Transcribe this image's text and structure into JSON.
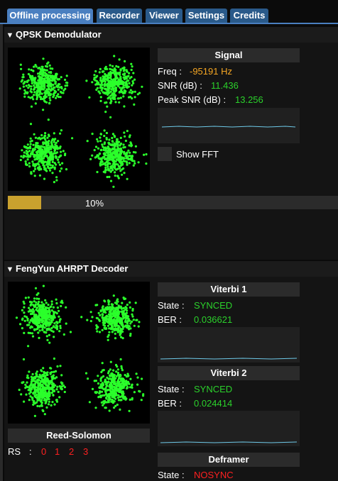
{
  "tabs": [
    {
      "label": "Offline processing",
      "active": true
    },
    {
      "label": "Recorder",
      "active": false
    },
    {
      "label": "Viewer",
      "active": false
    },
    {
      "label": "Settings",
      "active": false
    },
    {
      "label": "Credits",
      "active": false
    }
  ],
  "qpsk": {
    "title": "QPSK Demodulator",
    "signal_title": "Signal",
    "freq_label": "Freq :",
    "freq_value": "-95191 Hz",
    "snr_label": "SNR (dB) :",
    "snr_value": "11.436",
    "peak_label": "Peak SNR (dB) :",
    "peak_value": "13.256",
    "show_fft_label": "Show FFT",
    "progress_text": "10%",
    "progress_fraction": 0.1
  },
  "decoder": {
    "title": "FengYun AHRPT Decoder",
    "viterbi1": {
      "title": "Viterbi 1",
      "state_label": "State :",
      "state_value": "SYNCED",
      "ber_label": "BER :",
      "ber_value": "0.036621"
    },
    "viterbi2": {
      "title": "Viterbi 2",
      "state_label": "State :",
      "state_value": "SYNCED",
      "ber_label": "BER :",
      "ber_value": "0.024414"
    },
    "reed_solomon": {
      "title": "Reed-Solomon",
      "rs_label": "RS",
      "colon": ":",
      "values": [
        "0",
        "1",
        "2",
        "3"
      ]
    },
    "deframer": {
      "title": "Deframer",
      "state_label": "State :",
      "state_value": "NOSYNC"
    }
  },
  "colors": {
    "accent_tab": "#4a7fc0",
    "constellation_point": "#2bff2b",
    "synced": "#2bd12b",
    "nosync": "#ff2020",
    "freq": "#f5a623",
    "progress": "#c9a12e"
  }
}
